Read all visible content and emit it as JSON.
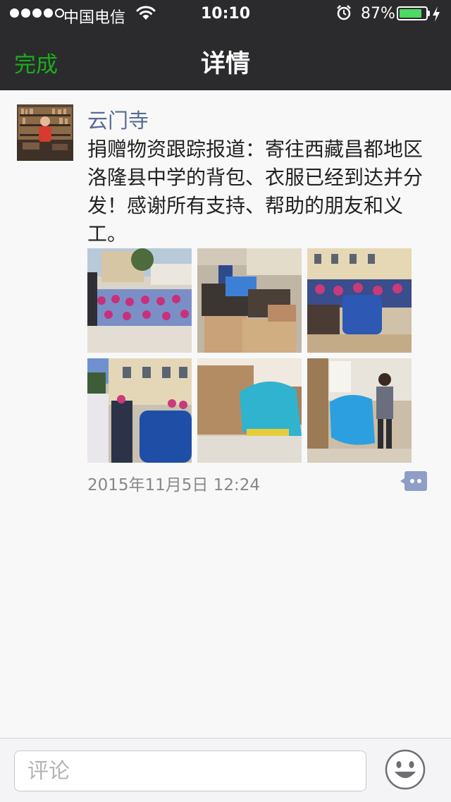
{
  "status_bar": {
    "carrier": "中国电信",
    "time": "10:10",
    "battery_percent": "87%",
    "battery_level": 0.87,
    "signal_bars_filled": 4,
    "signal_bars_total": 5
  },
  "nav": {
    "done_label": "完成",
    "title": "详情"
  },
  "post": {
    "author": "云门寺",
    "text": "捐赠物资跟踪报道：寄往西藏昌都地区洛隆县中学的背包、衣服已经到达并分发！感谢所有支持、帮助的朋友和义工。",
    "timestamp": "2015年11月5日 12:24",
    "photo_count": 6
  },
  "comment_bar": {
    "placeholder": "评论"
  },
  "colors": {
    "nav_background": "#2b2b2d",
    "accent_green": "#1aad19",
    "author_link": "#576b95",
    "battery_green": "#4cd964",
    "comment_icon": "#8d9fc7"
  },
  "icons": [
    "wifi-icon",
    "alarm-icon",
    "battery-icon",
    "charging-bolt-icon",
    "comment-icon",
    "emoji-icon"
  ]
}
